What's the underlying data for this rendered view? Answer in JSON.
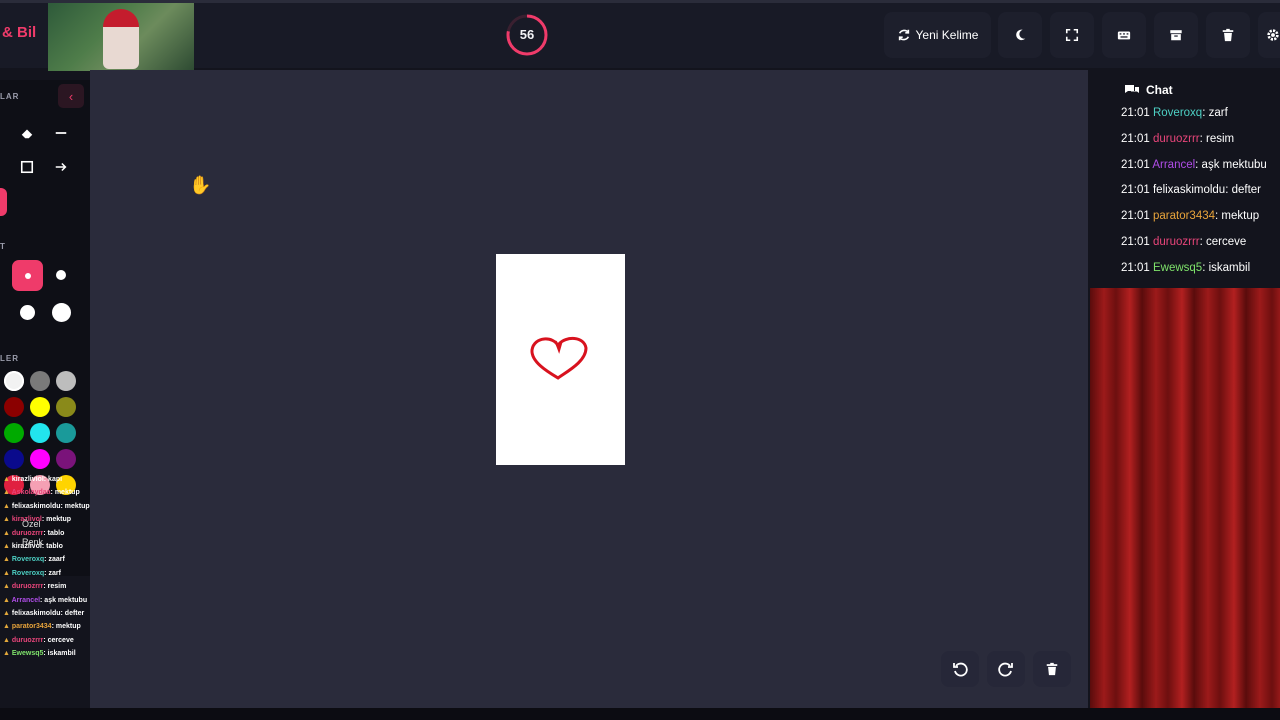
{
  "app": {
    "brand": "& Bil"
  },
  "timer": {
    "value": "56",
    "fraction_remaining": 0.78,
    "color": "#ef3b6a"
  },
  "toolbar": {
    "new_word_label": "Yeni Kelime",
    "icons": [
      "refresh-icon",
      "moon-icon",
      "fullscreen-icon",
      "keyboard-icon",
      "archive-icon",
      "trash-icon",
      "settings-icon"
    ]
  },
  "sidebar": {
    "tools_label": "LAR",
    "size_label": "T",
    "colors_label": "LER",
    "custom_color_label": "Özel",
    "custom_color_label2": "Renk",
    "palette": [
      "#f2f2f2",
      "#7a7a7a",
      "#bdbdbd",
      "#8b0000",
      "#ffff00",
      "#8a8a1a",
      "#00aa00",
      "#22e5ee",
      "#1a9a9a",
      "#0a0a8c",
      "#ff00ff",
      "#7a137a",
      "#e02040",
      "#f5a0b4",
      "#ffd400"
    ]
  },
  "chat": {
    "title": "Chat",
    "messages": [
      {
        "time": "21:01",
        "user": "Roveroxq",
        "text": ": zarf",
        "color": "#4dd0c4"
      },
      {
        "time": "21:01",
        "user": "duruozrrr",
        "text": ": resim",
        "color": "#e8457a"
      },
      {
        "time": "21:01",
        "user": "Arrancel",
        "text": ": aşk mektubu",
        "color": "#b04de8"
      },
      {
        "time": "21:01",
        "user": "felixaskimoldu",
        "text": ": defter",
        "color": "#ffffff"
      },
      {
        "time": "21:01",
        "user": "parator3434",
        "text": ": mektup",
        "color": "#e8a43b"
      },
      {
        "time": "21:01",
        "user": "duruozrrr",
        "text": ": cerceve",
        "color": "#e8457a"
      },
      {
        "time": "21:01",
        "user": "Ewewsq5",
        "text": ": iskambil",
        "color": "#7fe36b"
      }
    ]
  },
  "stream_chat": [
    {
      "user": "kirazliviol",
      "text": ": kapı",
      "color": "#ffffff"
    },
    {
      "user": "Askolaydaa",
      "text": ": mektup",
      "color": "#e8457a"
    },
    {
      "user": "felixaskimoldu",
      "text": ": mektup",
      "color": "#ffffff"
    },
    {
      "user": "kirazlivol",
      "text": ": mektup",
      "color": "#e8457a"
    },
    {
      "user": "duruozrrr",
      "text": ": tablo",
      "color": "#e8457a"
    },
    {
      "user": "kirazlivol",
      "text": ": tablo",
      "color": "#ffffff"
    },
    {
      "user": "Roveroxq",
      "text": ": zaarf",
      "color": "#4dd0c4"
    },
    {
      "user": "Roveroxq",
      "text": ": zarf",
      "color": "#4dd0c4"
    },
    {
      "user": "duruozrrr",
      "text": ": resim",
      "color": "#e8457a"
    },
    {
      "user": "Arrancel",
      "text": ": aşk mektubu",
      "color": "#b04de8"
    },
    {
      "user": "felixaskimoldu",
      "text": ": defter",
      "color": "#ffffff"
    },
    {
      "user": "parator3434",
      "text": ": mektup",
      "color": "#e8a43b"
    },
    {
      "user": "duruozrrr",
      "text": ": cerceve",
      "color": "#e8457a"
    },
    {
      "user": "Ewewsq5",
      "text": ": iskambil",
      "color": "#7fe36b"
    }
  ]
}
